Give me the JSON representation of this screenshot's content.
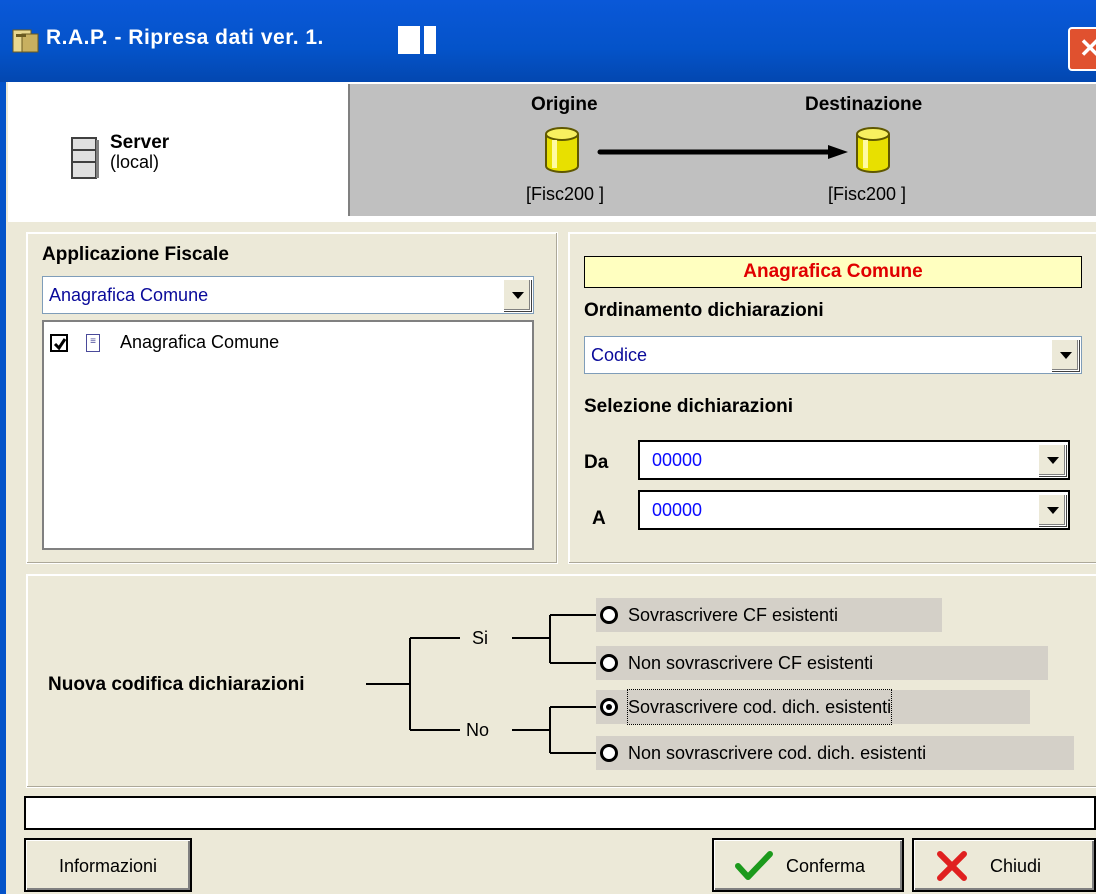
{
  "window": {
    "title": "R.A.P. - Ripresa dati ver. 1.",
    "close_glyph": "✕"
  },
  "server": {
    "label": "Server",
    "sublabel": "(local)"
  },
  "flow": {
    "origin_title": "Origine",
    "destination_title": "Destinazione",
    "origin_db": "[Fisc200  ]",
    "destination_db": "[Fisc200  ]"
  },
  "applicazione": {
    "label": "Applicazione Fiscale",
    "selected": "Anagrafica Comune",
    "items": [
      {
        "label": "Anagrafica Comune",
        "checked": true
      }
    ]
  },
  "dichiarazioni": {
    "header": "Anagrafica Comune",
    "ordinamento_label": "Ordinamento dichiarazioni",
    "ordinamento_value": "Codice",
    "selezione_label": "Selezione dichiarazioni",
    "da_label": "Da",
    "da_value": "00000",
    "a_label": "A",
    "a_value": "00000"
  },
  "codifica": {
    "label": "Nuova codifica dichiarazioni",
    "si_label": "Si",
    "no_label": "No",
    "options": [
      {
        "label": "Sovrascrivere CF esistenti",
        "selected": false
      },
      {
        "label": "Non sovrascrivere CF esistenti",
        "selected": false
      },
      {
        "label": "Sovrascrivere cod. dich. esistenti",
        "selected": true
      },
      {
        "label": "Non sovrascrivere cod. dich. esistenti",
        "selected": false
      }
    ]
  },
  "status": {
    "text": ""
  },
  "buttons": {
    "informazioni": "Informazioni",
    "conferma": "Conferma",
    "chiudi": "Chiudi"
  },
  "colors": {
    "titlebar": "#0453c9",
    "header_text": "#e00000",
    "header_bg": "#ffffc0",
    "field_text": "#0a0aff"
  },
  "icons": {
    "app": "app-icon",
    "server": "server-icon",
    "database": "database-icon",
    "arrow": "arrow-right-icon",
    "conferma": "checkmark-icon",
    "chiudi": "cross-icon"
  }
}
